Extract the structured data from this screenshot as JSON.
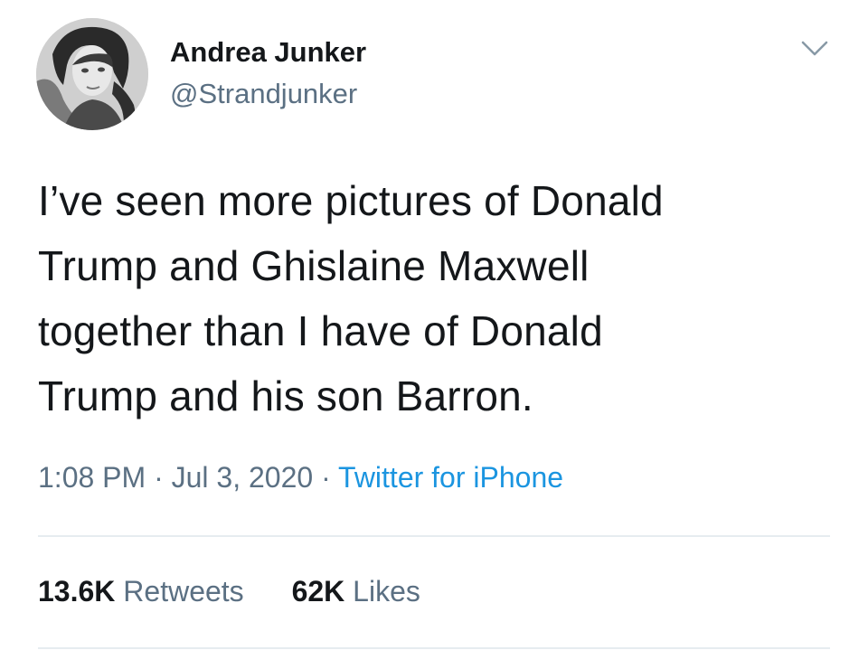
{
  "author": {
    "display_name": "Andrea Junker",
    "handle": "@Strandjunker",
    "avatar_icon": "profile-photo"
  },
  "tweet": {
    "lines": [
      "I’ve seen more pictures of Donald",
      "Trump and Ghislaine Maxwell",
      "together than I have of Donald",
      "Trump and his son Barron."
    ]
  },
  "meta": {
    "time": "1:08 PM",
    "separator": "·",
    "date": "Jul 3, 2020",
    "source": "Twitter for iPhone"
  },
  "stats": {
    "retweets_count": "13.6K",
    "retweets_label": "Retweets",
    "likes_count": "62K",
    "likes_label": "Likes"
  },
  "colors": {
    "text": "#14171a",
    "muted": "#5b7083",
    "link": "#1b95e0",
    "divider": "#e6ecf0"
  },
  "icons": {
    "menu": "chevron-down-icon"
  }
}
